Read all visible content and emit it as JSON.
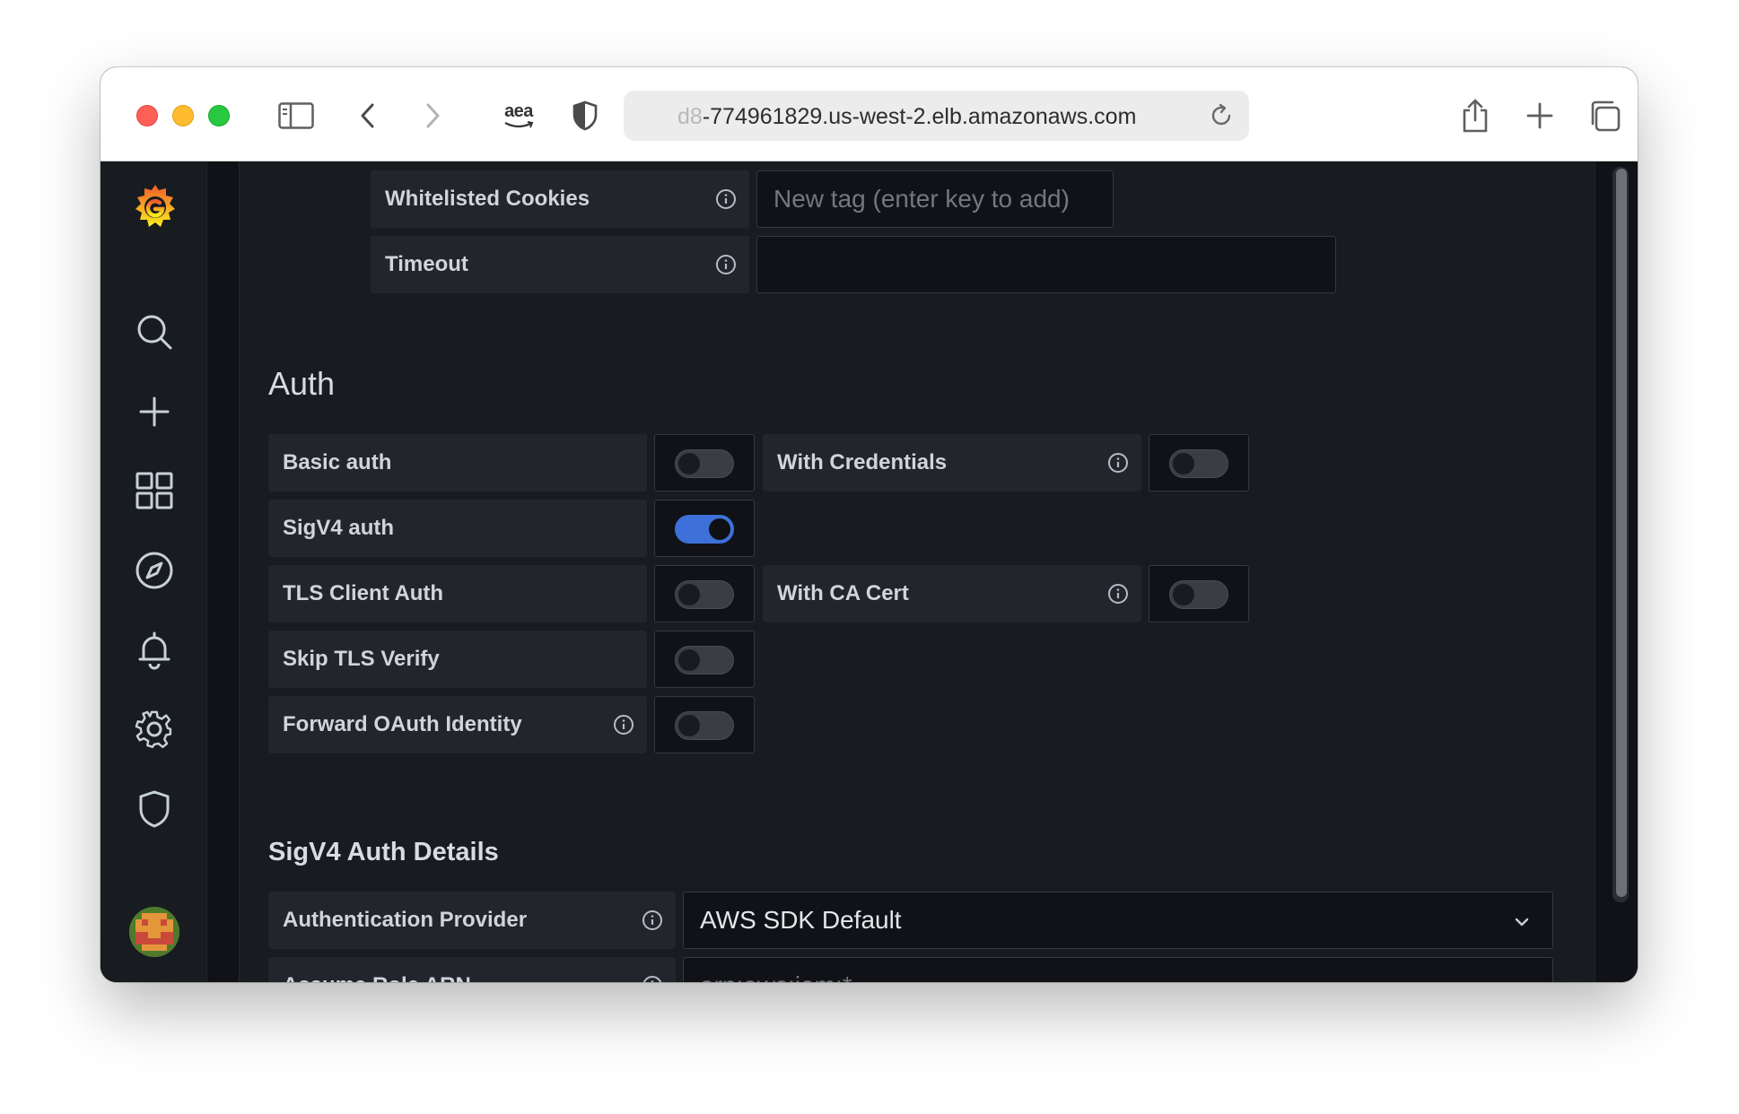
{
  "browser": {
    "url_faded": "d8",
    "url_main": "-774961829.us-west-2.elb.amazonaws.com",
    "extension_label": "aea"
  },
  "sidenav": {
    "items": [
      "grafana-logo",
      "search-icon",
      "plus-icon",
      "dashboards-icon",
      "explore-icon",
      "alerting-icon",
      "settings-icon",
      "shield-icon",
      "avatar"
    ]
  },
  "fields": {
    "whitelisted_cookies": {
      "label": "Whitelisted Cookies",
      "placeholder": "New tag (enter key to add)"
    },
    "timeout": {
      "label": "Timeout",
      "value": ""
    }
  },
  "auth": {
    "title": "Auth",
    "basic_auth": {
      "label": "Basic auth",
      "enabled": false
    },
    "with_credentials": {
      "label": "With Credentials",
      "enabled": false
    },
    "sigv4_auth": {
      "label": "SigV4 auth",
      "enabled": true
    },
    "tls_client_auth": {
      "label": "TLS Client Auth",
      "enabled": false
    },
    "with_ca_cert": {
      "label": "With CA Cert",
      "enabled": false
    },
    "skip_tls_verify": {
      "label": "Skip TLS Verify",
      "enabled": false
    },
    "forward_oauth": {
      "label": "Forward OAuth Identity",
      "enabled": false
    }
  },
  "sigv4": {
    "title": "SigV4 Auth Details",
    "auth_provider": {
      "label": "Authentication Provider",
      "value": "AWS SDK Default"
    },
    "assume_role": {
      "label": "Assume Role ARN",
      "placeholder": "arn:aws:iam:*"
    }
  },
  "colors": {
    "accent_blue": "#3d71d9",
    "panel_bg": "#181b1f",
    "label_bg": "#22252b",
    "grafana_orange": "#f46800"
  }
}
